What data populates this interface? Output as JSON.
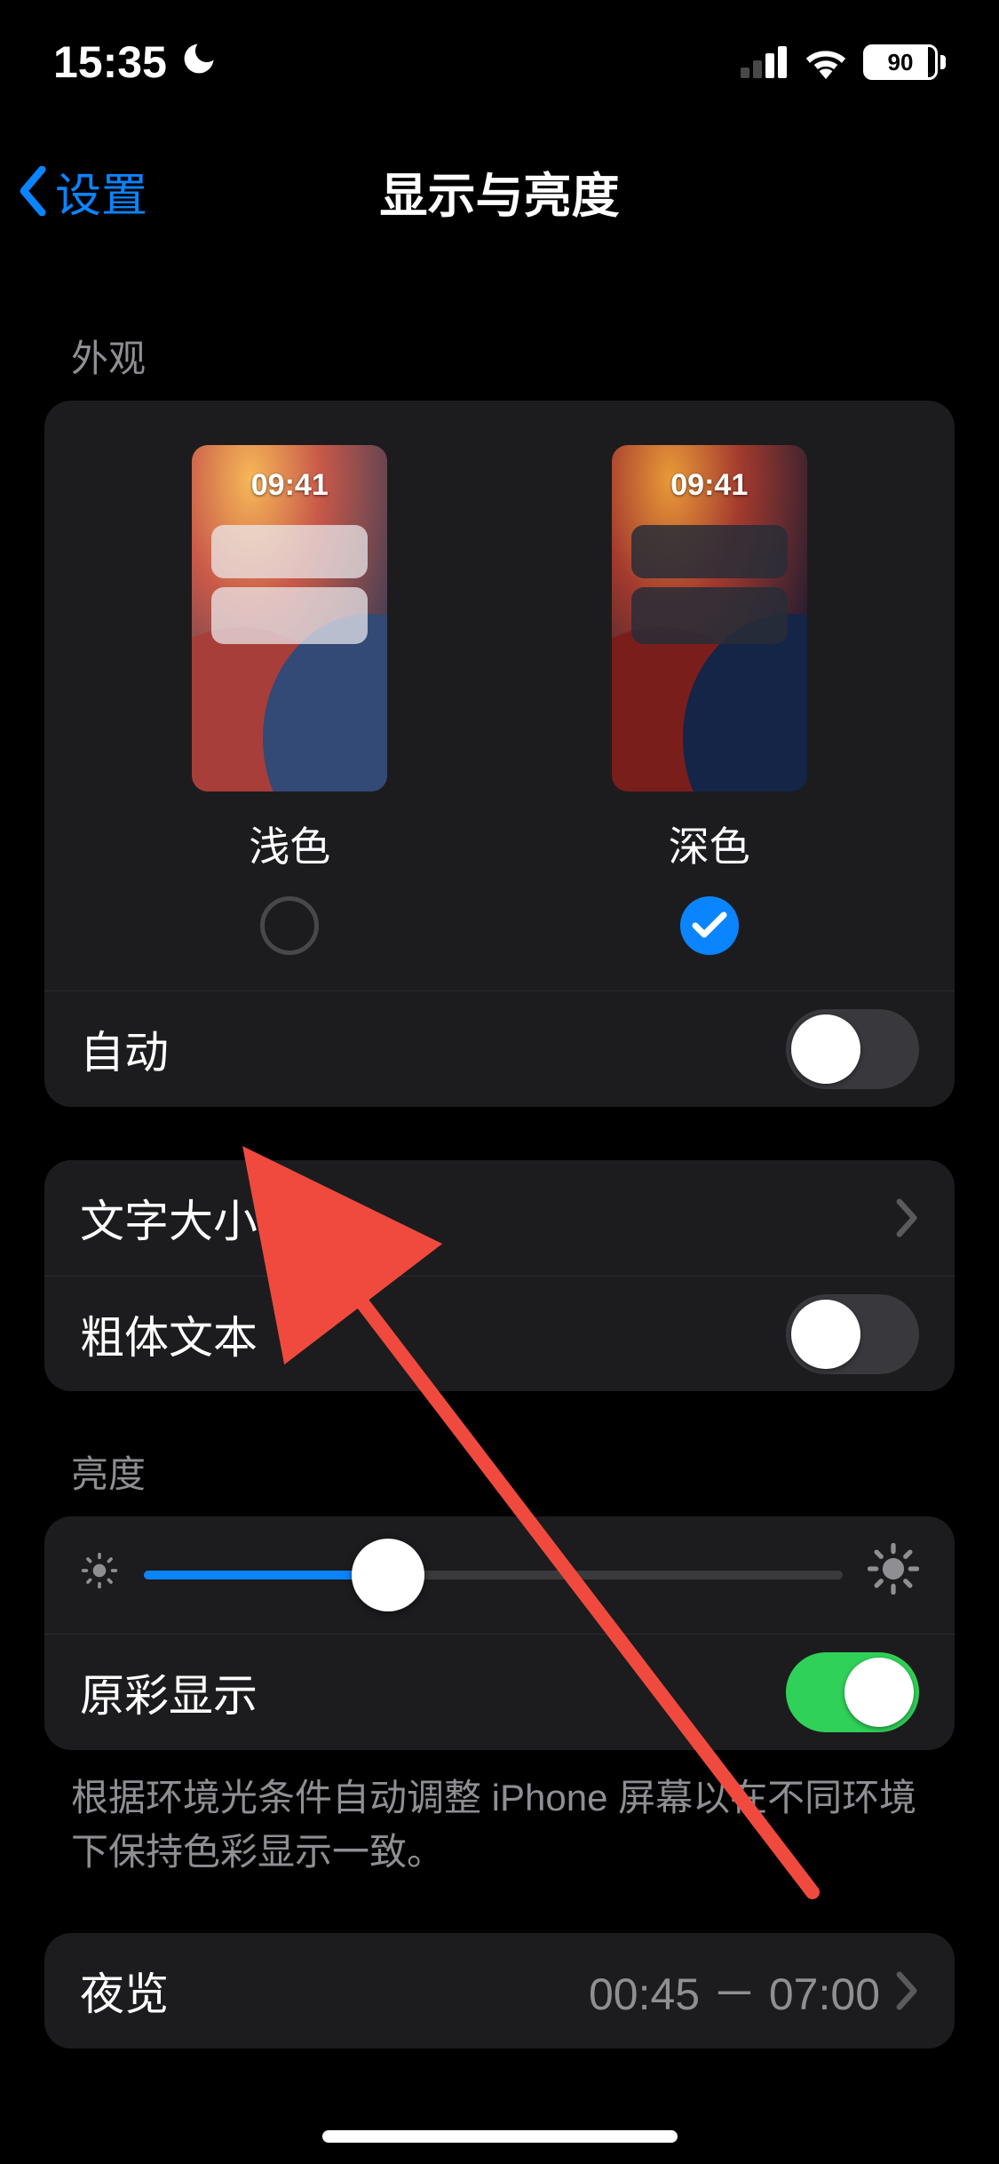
{
  "status": {
    "time": "15:35",
    "battery_percent": "90"
  },
  "nav": {
    "back_label": "设置",
    "title": "显示与亮度"
  },
  "appearance": {
    "section_header": "外观",
    "preview_time": "09:41",
    "light_label": "浅色",
    "dark_label": "深色",
    "selected": "dark",
    "auto_label": "自动",
    "auto_on": false
  },
  "text": {
    "text_size_label": "文字大小",
    "bold_text_label": "粗体文本",
    "bold_text_on": false
  },
  "brightness": {
    "section_header": "亮度",
    "value_percent": 35,
    "true_tone_label": "原彩显示",
    "true_tone_on": true,
    "footer": "根据环境光条件自动调整 iPhone 屏幕以在不同环境下保持色彩显示一致。"
  },
  "night_shift": {
    "label": "夜览",
    "schedule": "00:45 － 07:00"
  }
}
